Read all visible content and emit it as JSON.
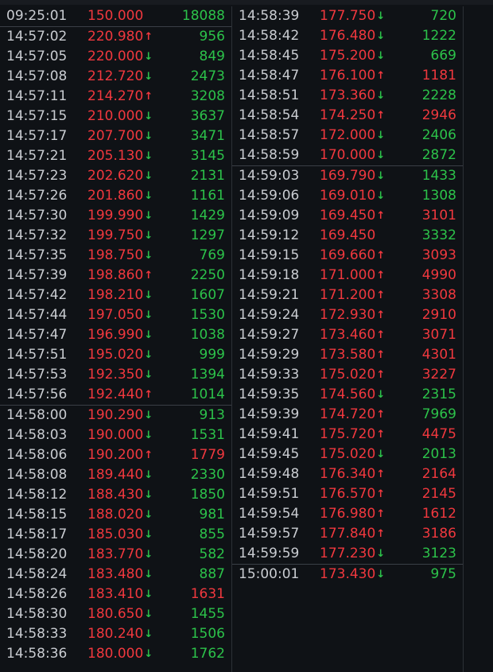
{
  "colors": {
    "up": "#f0383e",
    "down": "#2cc24a",
    "text": "#c9ccd1",
    "bg": "#0f1216"
  },
  "left": [
    {
      "time": "09:25:01",
      "price": "150.000",
      "dir": "none",
      "vol": "18088",
      "vcolor": "green"
    },
    {
      "time": "14:57:02",
      "price": "220.980",
      "dir": "up",
      "vol": "956",
      "vcolor": "green",
      "sep": true
    },
    {
      "time": "14:57:05",
      "price": "220.000",
      "dir": "down",
      "vol": "849",
      "vcolor": "green"
    },
    {
      "time": "14:57:08",
      "price": "212.720",
      "dir": "down",
      "vol": "2473",
      "vcolor": "green"
    },
    {
      "time": "14:57:11",
      "price": "214.270",
      "dir": "up",
      "vol": "3208",
      "vcolor": "green"
    },
    {
      "time": "14:57:15",
      "price": "210.000",
      "dir": "down",
      "vol": "3637",
      "vcolor": "green"
    },
    {
      "time": "14:57:17",
      "price": "207.700",
      "dir": "down",
      "vol": "3471",
      "vcolor": "green"
    },
    {
      "time": "14:57:21",
      "price": "205.130",
      "dir": "down",
      "vol": "3145",
      "vcolor": "green"
    },
    {
      "time": "14:57:23",
      "price": "202.620",
      "dir": "down",
      "vol": "2131",
      "vcolor": "green"
    },
    {
      "time": "14:57:26",
      "price": "201.860",
      "dir": "down",
      "vol": "1161",
      "vcolor": "green"
    },
    {
      "time": "14:57:30",
      "price": "199.990",
      "dir": "down",
      "vol": "1429",
      "vcolor": "green"
    },
    {
      "time": "14:57:32",
      "price": "199.750",
      "dir": "down",
      "vol": "1297",
      "vcolor": "green"
    },
    {
      "time": "14:57:35",
      "price": "198.750",
      "dir": "down",
      "vol": "769",
      "vcolor": "green"
    },
    {
      "time": "14:57:39",
      "price": "198.860",
      "dir": "up",
      "vol": "2250",
      "vcolor": "green"
    },
    {
      "time": "14:57:42",
      "price": "198.210",
      "dir": "down",
      "vol": "1607",
      "vcolor": "green"
    },
    {
      "time": "14:57:44",
      "price": "197.050",
      "dir": "down",
      "vol": "1530",
      "vcolor": "green"
    },
    {
      "time": "14:57:47",
      "price": "196.990",
      "dir": "down",
      "vol": "1038",
      "vcolor": "green"
    },
    {
      "time": "14:57:51",
      "price": "195.020",
      "dir": "down",
      "vol": "999",
      "vcolor": "green"
    },
    {
      "time": "14:57:53",
      "price": "192.350",
      "dir": "down",
      "vol": "1394",
      "vcolor": "green"
    },
    {
      "time": "14:57:56",
      "price": "192.440",
      "dir": "up",
      "vol": "1014",
      "vcolor": "green"
    },
    {
      "time": "14:58:00",
      "price": "190.290",
      "dir": "down",
      "vol": "913",
      "vcolor": "green",
      "sep": true
    },
    {
      "time": "14:58:03",
      "price": "190.000",
      "dir": "down",
      "vol": "1531",
      "vcolor": "green"
    },
    {
      "time": "14:58:06",
      "price": "190.200",
      "dir": "up",
      "vol": "1779",
      "vcolor": "red"
    },
    {
      "time": "14:58:08",
      "price": "189.440",
      "dir": "down",
      "vol": "2330",
      "vcolor": "green"
    },
    {
      "time": "14:58:12",
      "price": "188.430",
      "dir": "down",
      "vol": "1850",
      "vcolor": "green"
    },
    {
      "time": "14:58:15",
      "price": "188.020",
      "dir": "down",
      "vol": "981",
      "vcolor": "green"
    },
    {
      "time": "14:58:17",
      "price": "185.030",
      "dir": "down",
      "vol": "855",
      "vcolor": "green"
    },
    {
      "time": "14:58:20",
      "price": "183.770",
      "dir": "down",
      "vol": "582",
      "vcolor": "green"
    },
    {
      "time": "14:58:24",
      "price": "183.480",
      "dir": "down",
      "vol": "887",
      "vcolor": "green"
    },
    {
      "time": "14:58:26",
      "price": "183.410",
      "dir": "down",
      "vol": "1631",
      "vcolor": "red"
    },
    {
      "time": "14:58:30",
      "price": "180.650",
      "dir": "down",
      "vol": "1455",
      "vcolor": "green"
    },
    {
      "time": "14:58:33",
      "price": "180.240",
      "dir": "down",
      "vol": "1506",
      "vcolor": "green"
    },
    {
      "time": "14:58:36",
      "price": "180.000",
      "dir": "down",
      "vol": "1762",
      "vcolor": "green"
    }
  ],
  "right": [
    {
      "time": "14:58:39",
      "price": "177.750",
      "dir": "down",
      "vol": "720",
      "vcolor": "green"
    },
    {
      "time": "14:58:42",
      "price": "176.480",
      "dir": "down",
      "vol": "1222",
      "vcolor": "green"
    },
    {
      "time": "14:58:45",
      "price": "175.200",
      "dir": "down",
      "vol": "669",
      "vcolor": "green"
    },
    {
      "time": "14:58:47",
      "price": "176.100",
      "dir": "up",
      "vol": "1181",
      "vcolor": "red"
    },
    {
      "time": "14:58:51",
      "price": "173.360",
      "dir": "down",
      "vol": "2228",
      "vcolor": "green"
    },
    {
      "time": "14:58:54",
      "price": "174.250",
      "dir": "up",
      "vol": "2946",
      "vcolor": "red"
    },
    {
      "time": "14:58:57",
      "price": "172.000",
      "dir": "down",
      "vol": "2406",
      "vcolor": "green"
    },
    {
      "time": "14:58:59",
      "price": "170.000",
      "dir": "down",
      "vol": "2872",
      "vcolor": "green"
    },
    {
      "time": "14:59:03",
      "price": "169.790",
      "dir": "down",
      "vol": "1433",
      "vcolor": "green",
      "sep": true
    },
    {
      "time": "14:59:06",
      "price": "169.010",
      "dir": "down",
      "vol": "1308",
      "vcolor": "green"
    },
    {
      "time": "14:59:09",
      "price": "169.450",
      "dir": "up",
      "vol": "3101",
      "vcolor": "red"
    },
    {
      "time": "14:59:12",
      "price": "169.450",
      "dir": "none",
      "vol": "3332",
      "vcolor": "green"
    },
    {
      "time": "14:59:15",
      "price": "169.660",
      "dir": "up",
      "vol": "3093",
      "vcolor": "red"
    },
    {
      "time": "14:59:18",
      "price": "171.000",
      "dir": "up",
      "vol": "4990",
      "vcolor": "red"
    },
    {
      "time": "14:59:21",
      "price": "171.200",
      "dir": "up",
      "vol": "3308",
      "vcolor": "red"
    },
    {
      "time": "14:59:24",
      "price": "172.930",
      "dir": "up",
      "vol": "2910",
      "vcolor": "red"
    },
    {
      "time": "14:59:27",
      "price": "173.460",
      "dir": "up",
      "vol": "3071",
      "vcolor": "red"
    },
    {
      "time": "14:59:29",
      "price": "173.580",
      "dir": "up",
      "vol": "4301",
      "vcolor": "red"
    },
    {
      "time": "14:59:33",
      "price": "175.020",
      "dir": "up",
      "vol": "3227",
      "vcolor": "red"
    },
    {
      "time": "14:59:35",
      "price": "174.560",
      "dir": "down",
      "vol": "2315",
      "vcolor": "green"
    },
    {
      "time": "14:59:39",
      "price": "174.720",
      "dir": "up",
      "vol": "7969",
      "vcolor": "green"
    },
    {
      "time": "14:59:41",
      "price": "175.720",
      "dir": "up",
      "vol": "4475",
      "vcolor": "red"
    },
    {
      "time": "14:59:45",
      "price": "175.020",
      "dir": "down",
      "vol": "2013",
      "vcolor": "green"
    },
    {
      "time": "14:59:48",
      "price": "176.340",
      "dir": "up",
      "vol": "2164",
      "vcolor": "red"
    },
    {
      "time": "14:59:51",
      "price": "176.570",
      "dir": "up",
      "vol": "2145",
      "vcolor": "red"
    },
    {
      "time": "14:59:54",
      "price": "176.980",
      "dir": "up",
      "vol": "1612",
      "vcolor": "red"
    },
    {
      "time": "14:59:57",
      "price": "177.840",
      "dir": "up",
      "vol": "3186",
      "vcolor": "red"
    },
    {
      "time": "14:59:59",
      "price": "177.230",
      "dir": "down",
      "vol": "3123",
      "vcolor": "green"
    },
    {
      "time": "15:00:01",
      "price": "173.430",
      "dir": "down",
      "vol": "975",
      "vcolor": "green",
      "sep": true
    }
  ]
}
